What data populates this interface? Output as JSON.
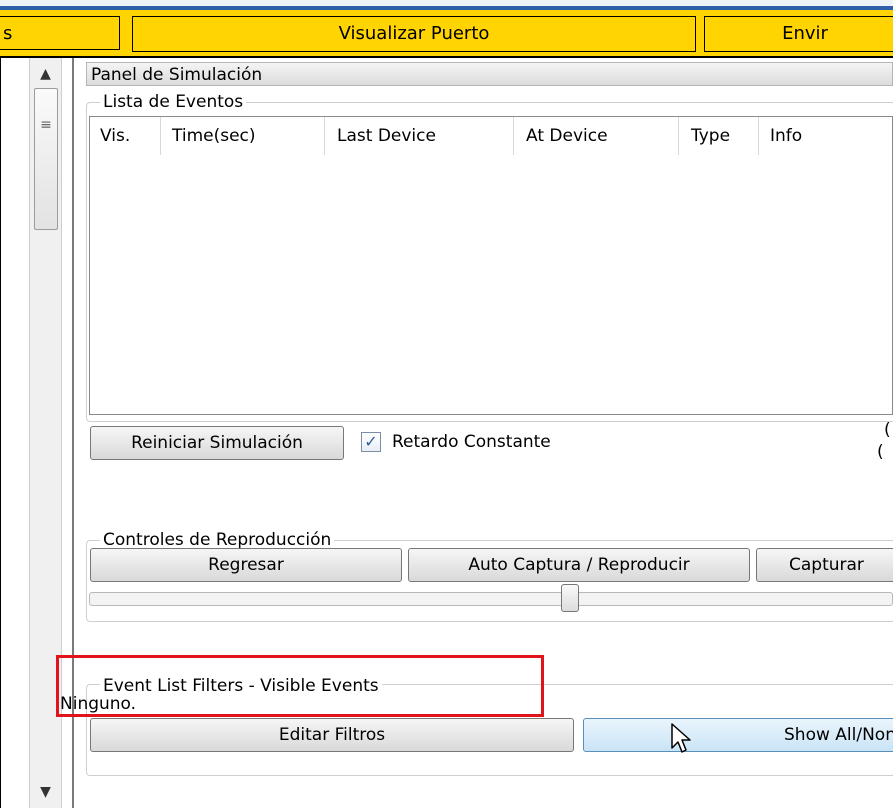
{
  "toolbar": {
    "tab_left": "s",
    "tab_center": "Visualizar Puerto",
    "tab_right": "Envir"
  },
  "panel": {
    "title": "Panel de Simulación"
  },
  "event_list": {
    "group_title": "Lista de Eventos",
    "columns": [
      "Vis.",
      "Time(sec)",
      "Last Device",
      "At Device",
      "Type",
      "Info"
    ]
  },
  "simulation": {
    "reset_button": "Reiniciar Simulación",
    "constant_delay_label": "Retardo Constante",
    "constant_delay_checked": true,
    "right_clip_top": "(",
    "right_clip_bottom": "("
  },
  "playback": {
    "group_title": "Controles de Reproducción",
    "back_button": "Regresar",
    "auto_capture_button": "Auto Captura / Reproducir",
    "capture_button": "Capturar",
    "slider_position": 0.6
  },
  "filters": {
    "group_title": "Event List Filters - Visible Events",
    "value": "Ninguno.",
    "edit_button": "Editar Filtros",
    "show_all_button": "Show All/Non"
  },
  "colors": {
    "toolbar_bg": "#ffd400",
    "highlight_box": "#e1141c",
    "checkbox_check": "#2a5d9c"
  },
  "icons": {
    "scroll_up": "scroll-up-arrow-icon",
    "scroll_down": "scroll-down-arrow-icon",
    "grip": "scroll-grip-icon",
    "cursor": "mouse-pointer-icon"
  }
}
